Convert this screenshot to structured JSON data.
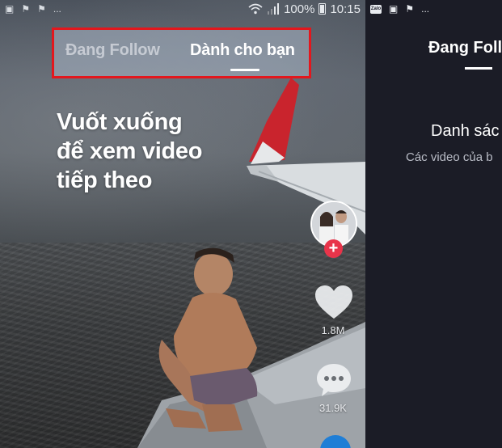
{
  "status_bar": {
    "battery": "100%",
    "time": "10:15",
    "notif_more": "..."
  },
  "tabs": {
    "following": "Đang Follow",
    "for_you": "Dành cho bạn"
  },
  "hint": {
    "line1": "Vuốt xuống",
    "line2": "để xem video",
    "line3": "tiếp theo"
  },
  "actions": {
    "like_count": "1.8M",
    "comment_count": "31.9K",
    "follow_symbol": "+"
  },
  "right_panel": {
    "status_app_label": "Zalo",
    "notif_more": "...",
    "tab": "Đang Foll",
    "title": "Danh sác",
    "subtitle": "Các video của b"
  },
  "colors": {
    "highlight_border": "#e3171d",
    "follow_plus": "#e8344a",
    "share": "#1f7ed6",
    "right_bg": "#1b1c26"
  }
}
